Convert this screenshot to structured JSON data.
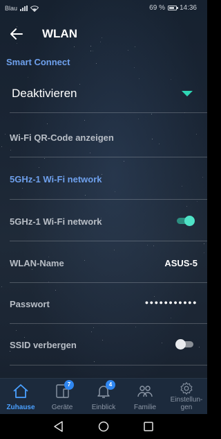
{
  "status_bar": {
    "carrier": "Blau",
    "battery": "69 %",
    "time": "14:36"
  },
  "header": {
    "title": "WLAN",
    "back_icon": "arrow-left-icon"
  },
  "smart_connect": {
    "label": "Smart Connect",
    "value": "Deaktivieren"
  },
  "qr_code": {
    "label": "Wi-Fi QR-Code anzeigen"
  },
  "band": {
    "section_label": "5GHz-1 Wi-Fi network",
    "enable_label": "5GHz-1 Wi-Fi network",
    "enabled": true,
    "ssid_label": "WLAN-Name",
    "ssid_value": "ASUS-5",
    "password_label": "Passwort",
    "password_value": "●●●●●●●●●●●",
    "hide_ssid_label": "SSID verbergen",
    "hide_ssid": false
  },
  "colors": {
    "accent": "#6ea0ec",
    "toggle_on": "#4fe3c7",
    "active_nav": "#4aa0ff",
    "badge": "#2f86f0"
  },
  "bottom_nav": [
    {
      "label": "Zuhause",
      "icon": "home-icon",
      "active": true
    },
    {
      "label": "Geräte",
      "icon": "devices-icon",
      "badge": "7"
    },
    {
      "label": "Einblick",
      "icon": "bell-icon",
      "badge": "4"
    },
    {
      "label": "Familie",
      "icon": "family-icon"
    },
    {
      "label": "Einstellun-\ngen",
      "icon": "gear-icon"
    }
  ],
  "system_nav": [
    "back-triangle-icon",
    "home-circle-icon",
    "recents-square-icon"
  ]
}
